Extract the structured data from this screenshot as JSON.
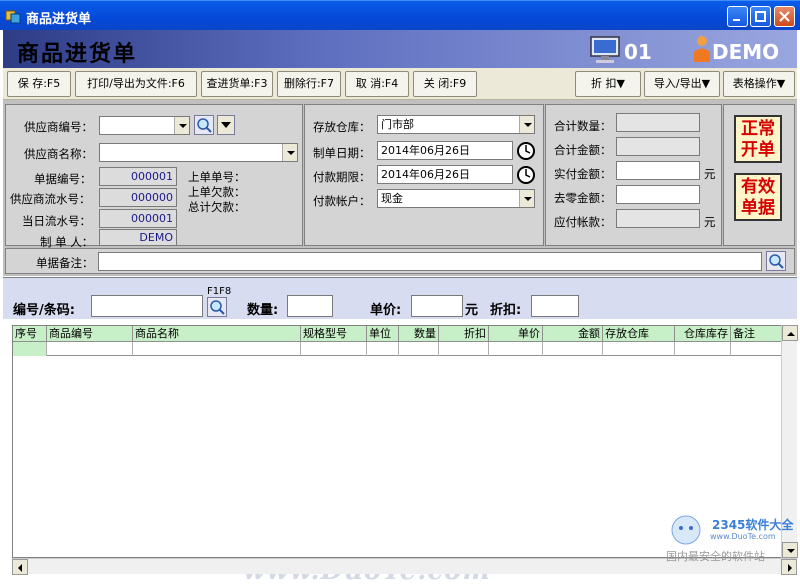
{
  "window": {
    "title": "商品进货单"
  },
  "banner": {
    "title": "商品进货单",
    "station": "01",
    "user": "DEMO"
  },
  "toolbar": {
    "save": "保 存:F5",
    "print": "打印/导出为文件:F6",
    "query": "查进货单:F3",
    "delete_row": "删除行:F7",
    "cancel": "取 消:F4",
    "close": "关 闭:F9",
    "discount": "折 扣▼",
    "import_export": "导入/导出▼",
    "table_ops": "表格操作▼"
  },
  "form": {
    "supplier_code_label": "供应商编号：",
    "supplier_code": "",
    "supplier_name_label": "供应商名称：",
    "supplier_name": "",
    "doc_no_label": "单据编号：",
    "doc_no": "000001",
    "supplier_serial_label": "供应商流水号：",
    "supplier_serial": "000000",
    "daily_serial_label": "当日流水号：",
    "daily_serial": "000001",
    "maker_label": "制 单 人：",
    "maker": "DEMO",
    "last_doc_label": "上单单号：",
    "last_owed_label": "上单欠款：",
    "total_owed_label": "总计欠款：",
    "warehouse_label": "存放仓库：",
    "warehouse": "门市部",
    "make_date_label": "制单日期：",
    "make_date": "2014年06月26日",
    "pay_due_label": "付款期限：",
    "pay_due": "2014年06月26日",
    "pay_account_label": "付款帐户：",
    "pay_account": "现金",
    "total_qty_label": "合计数量：",
    "total_amount_label": "合计金额：",
    "paid_amount_label": "实付金额：",
    "round_off_label": "去零金额：",
    "payable_label": "应付帐款：",
    "yuan": "元",
    "stamp_normal": "正常开单",
    "stamp_valid": "有效单据",
    "remark_label": "单据备注："
  },
  "entry": {
    "code_label": "编号/条码:",
    "hint": "F1F8",
    "qty_label": "数量:",
    "price_label": "单价:",
    "yuan": "元",
    "discount_label": "折扣:"
  },
  "grid": {
    "columns": [
      "序号",
      "商品编号",
      "商品名称",
      "规格型号",
      "单位",
      "数量",
      "折扣",
      "单价",
      "金额",
      "存放仓库",
      "仓库库存",
      "备注"
    ]
  },
  "watermark": "www.DuoTe.com",
  "corner_logo": {
    "line1": "2345软件大全",
    "line2": "www.DuoTe.com",
    "line3": "国内最安全的软件站"
  },
  "colors": {
    "titlebar": "#0548d8",
    "banner_start": "#2e3c86",
    "grid_header": "#c8f0c8",
    "stamp_text": "#d60000"
  }
}
